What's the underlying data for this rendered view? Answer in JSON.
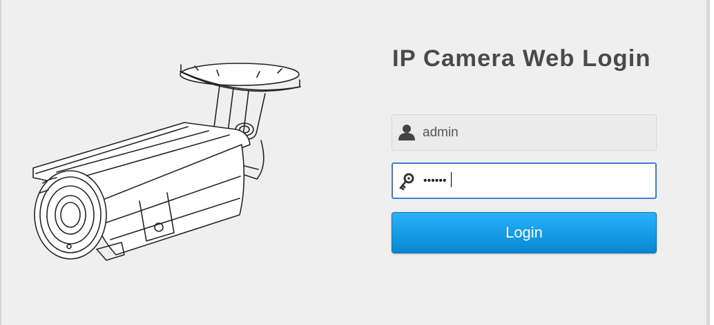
{
  "page": {
    "title": "IP Camera Web Login"
  },
  "illustration": {
    "icon": "security-camera-icon"
  },
  "form": {
    "username": {
      "icon": "user-icon",
      "value": "admin"
    },
    "password": {
      "icon": "key-icon",
      "value": "••••••"
    },
    "login_label": "Login"
  },
  "colors": {
    "background": "#efeff0",
    "accent": "#17a0ea",
    "focus_border": "#3b7dd8",
    "title": "#4a4a4a"
  }
}
